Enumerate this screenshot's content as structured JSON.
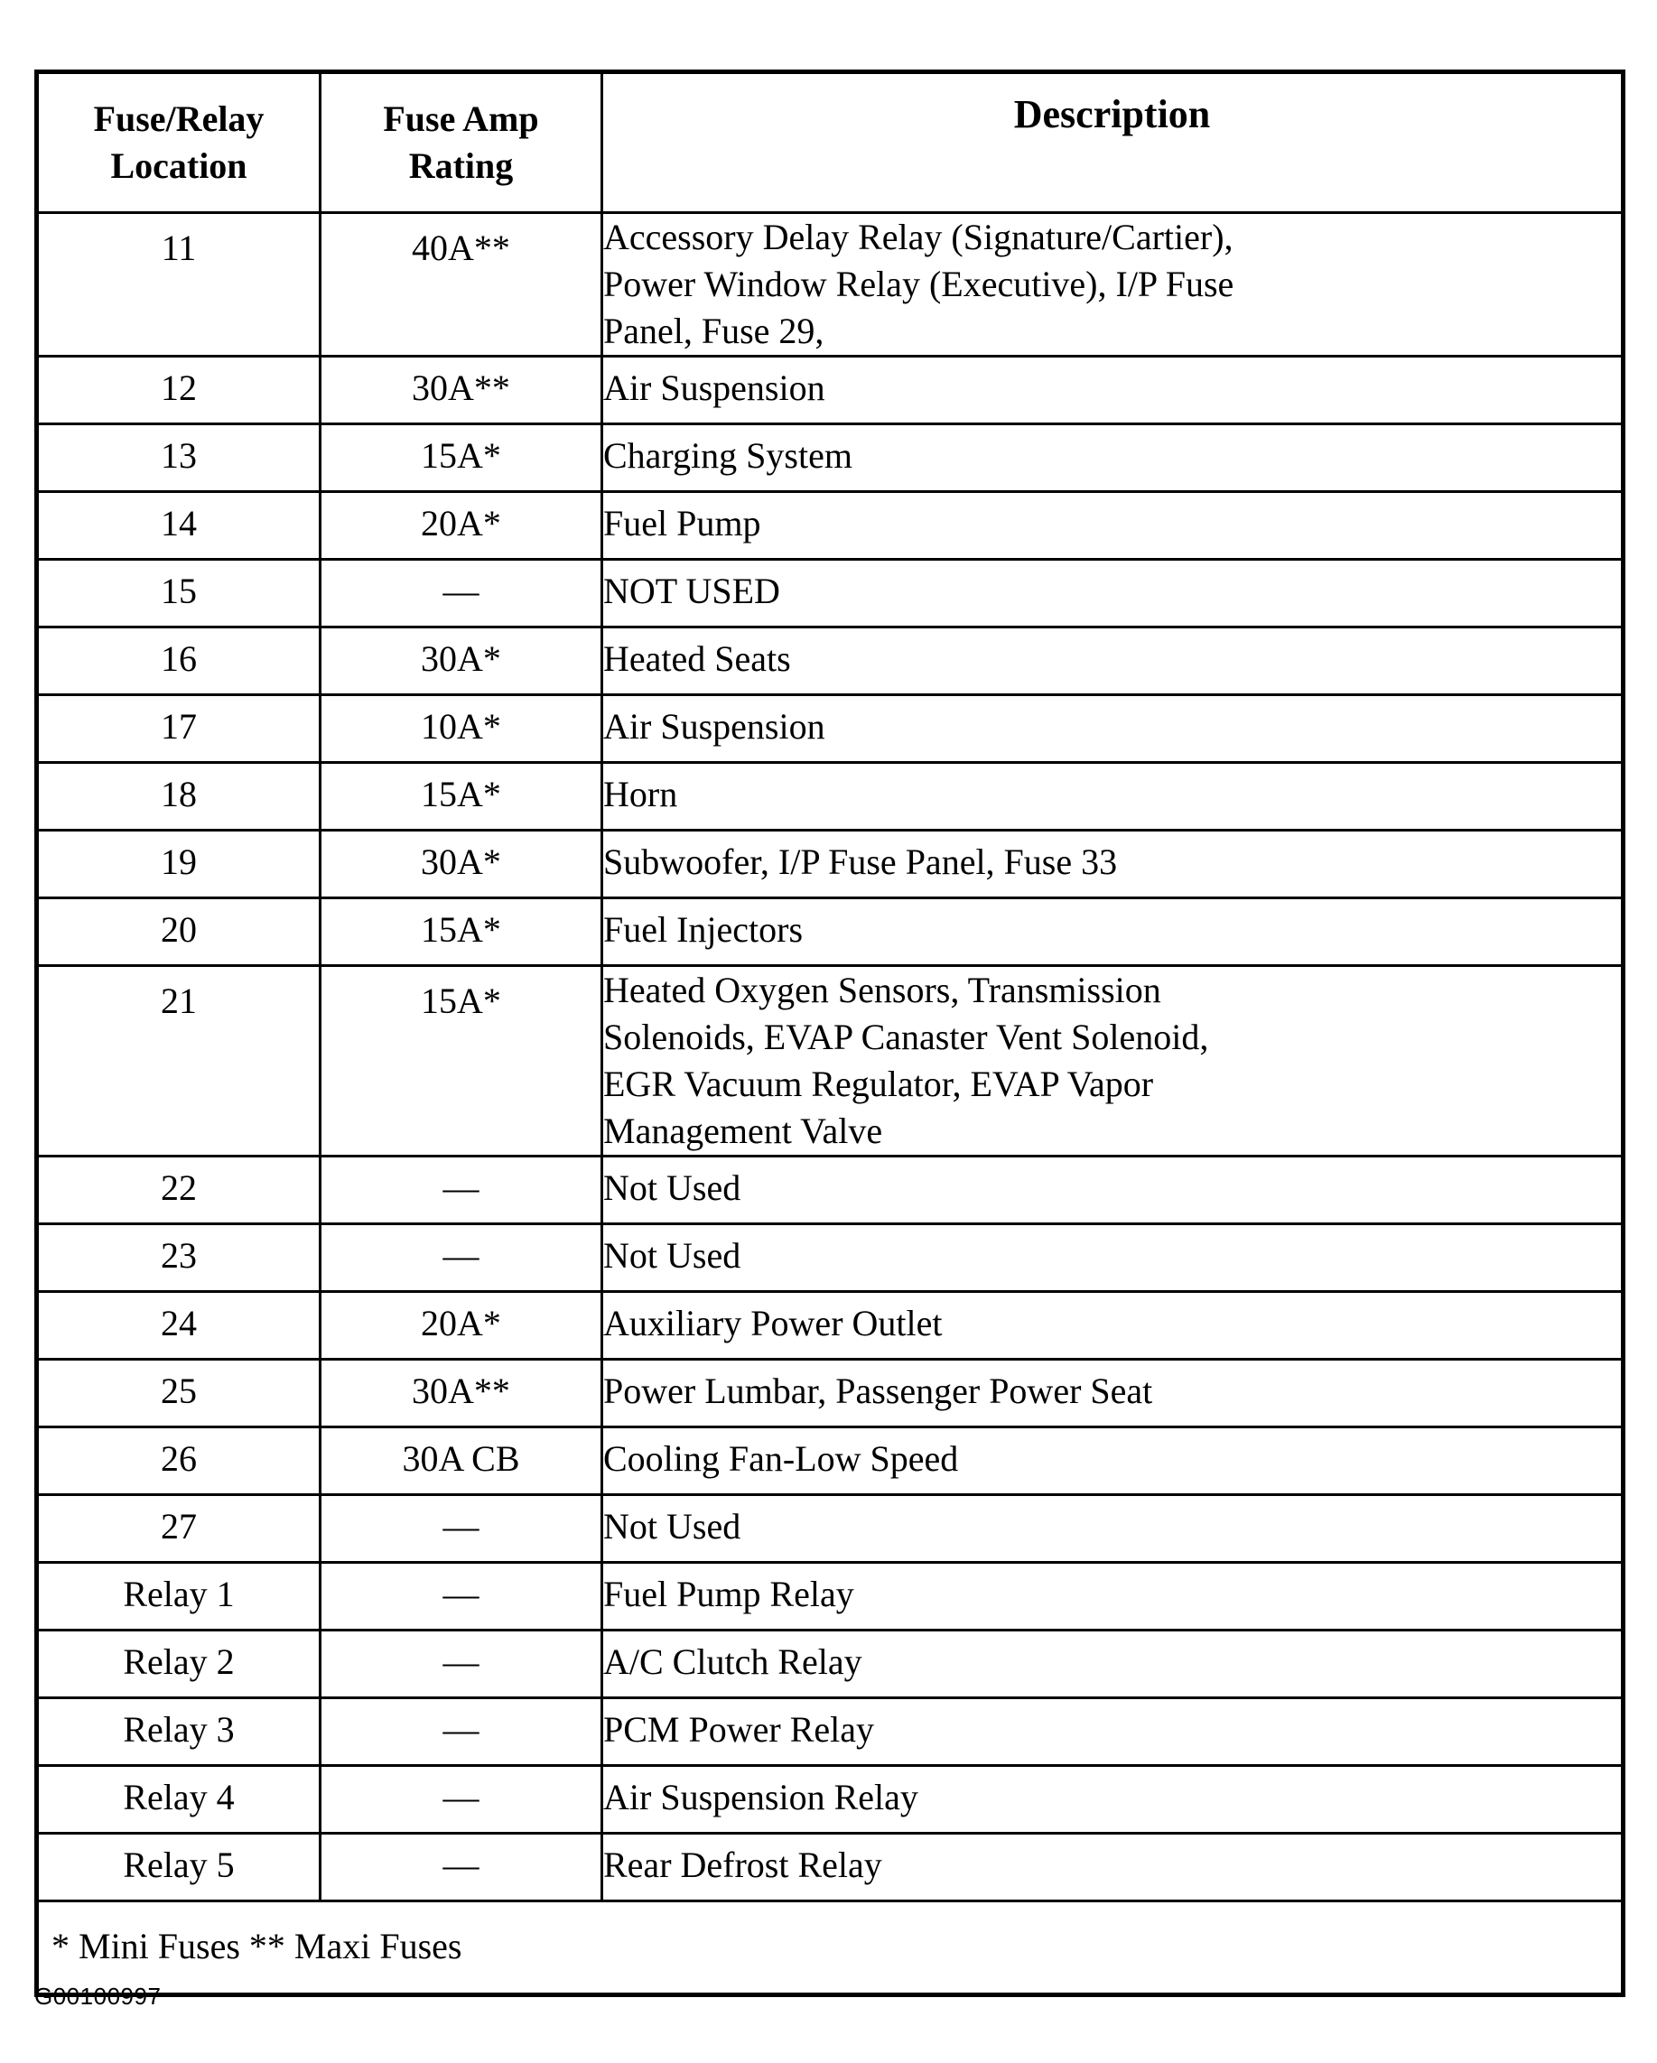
{
  "table": {
    "columns": [
      {
        "id": "location",
        "header": "Fuse/Relay\nLocation",
        "header_line1": "Fuse/Relay",
        "header_line2": "Location"
      },
      {
        "id": "amp_rating",
        "header": "Fuse Amp\nRating",
        "header_line1": "Fuse Amp",
        "header_line2": "Rating"
      },
      {
        "id": "description",
        "header": "Description"
      }
    ],
    "rows": [
      {
        "location": "11",
        "amp_rating": "40A**",
        "description_lines": [
          "Accessory Delay Relay (Signature/Cartier),",
          "Power Window Relay (Executive), I/P Fuse",
          "Panel, Fuse 29,"
        ]
      },
      {
        "location": "12",
        "amp_rating": "30A**",
        "description_lines": [
          "Air Suspension"
        ]
      },
      {
        "location": "13",
        "amp_rating": "15A*",
        "description_lines": [
          "Charging System"
        ]
      },
      {
        "location": "14",
        "amp_rating": "20A*",
        "description_lines": [
          "Fuel Pump"
        ]
      },
      {
        "location": "15",
        "amp_rating": "—",
        "description_lines": [
          "NOT USED"
        ]
      },
      {
        "location": "16",
        "amp_rating": "30A*",
        "description_lines": [
          "Heated Seats"
        ]
      },
      {
        "location": "17",
        "amp_rating": "10A*",
        "description_lines": [
          "Air Suspension"
        ]
      },
      {
        "location": "18",
        "amp_rating": "15A*",
        "description_lines": [
          "Horn"
        ]
      },
      {
        "location": "19",
        "amp_rating": "30A*",
        "description_lines": [
          "Subwoofer, I/P Fuse Panel, Fuse 33"
        ]
      },
      {
        "location": "20",
        "amp_rating": "15A*",
        "description_lines": [
          "Fuel Injectors"
        ]
      },
      {
        "location": "21",
        "amp_rating": "15A*",
        "description_lines": [
          "Heated Oxygen Sensors, Transmission",
          "Solenoids, EVAP Canaster Vent Solenoid,",
          "EGR Vacuum Regulator, EVAP Vapor",
          "Management Valve"
        ]
      },
      {
        "location": "22",
        "amp_rating": "—",
        "description_lines": [
          "Not Used"
        ]
      },
      {
        "location": "23",
        "amp_rating": "—",
        "description_lines": [
          "Not Used"
        ]
      },
      {
        "location": "24",
        "amp_rating": "20A*",
        "description_lines": [
          "Auxiliary Power Outlet"
        ]
      },
      {
        "location": "25",
        "amp_rating": "30A**",
        "description_lines": [
          "Power Lumbar, Passenger Power Seat"
        ]
      },
      {
        "location": "26",
        "amp_rating": "30A CB",
        "description_lines": [
          "Cooling Fan-Low Speed"
        ]
      },
      {
        "location": "27",
        "amp_rating": "—",
        "description_lines": [
          "Not Used"
        ]
      },
      {
        "location": "Relay 1",
        "amp_rating": "—",
        "description_lines": [
          "Fuel Pump Relay"
        ]
      },
      {
        "location": "Relay 2",
        "amp_rating": "—",
        "description_lines": [
          "A/C Clutch Relay"
        ]
      },
      {
        "location": "Relay 3",
        "amp_rating": "—",
        "description_lines": [
          "PCM Power Relay"
        ]
      },
      {
        "location": "Relay 4",
        "amp_rating": "—",
        "description_lines": [
          "Air Suspension Relay"
        ]
      },
      {
        "location": "Relay 5",
        "amp_rating": "—",
        "description_lines": [
          "Rear Defrost Relay"
        ]
      }
    ],
    "footnote": "* Mini Fuses ** Maxi Fuses"
  },
  "figure_id": "G00100997"
}
